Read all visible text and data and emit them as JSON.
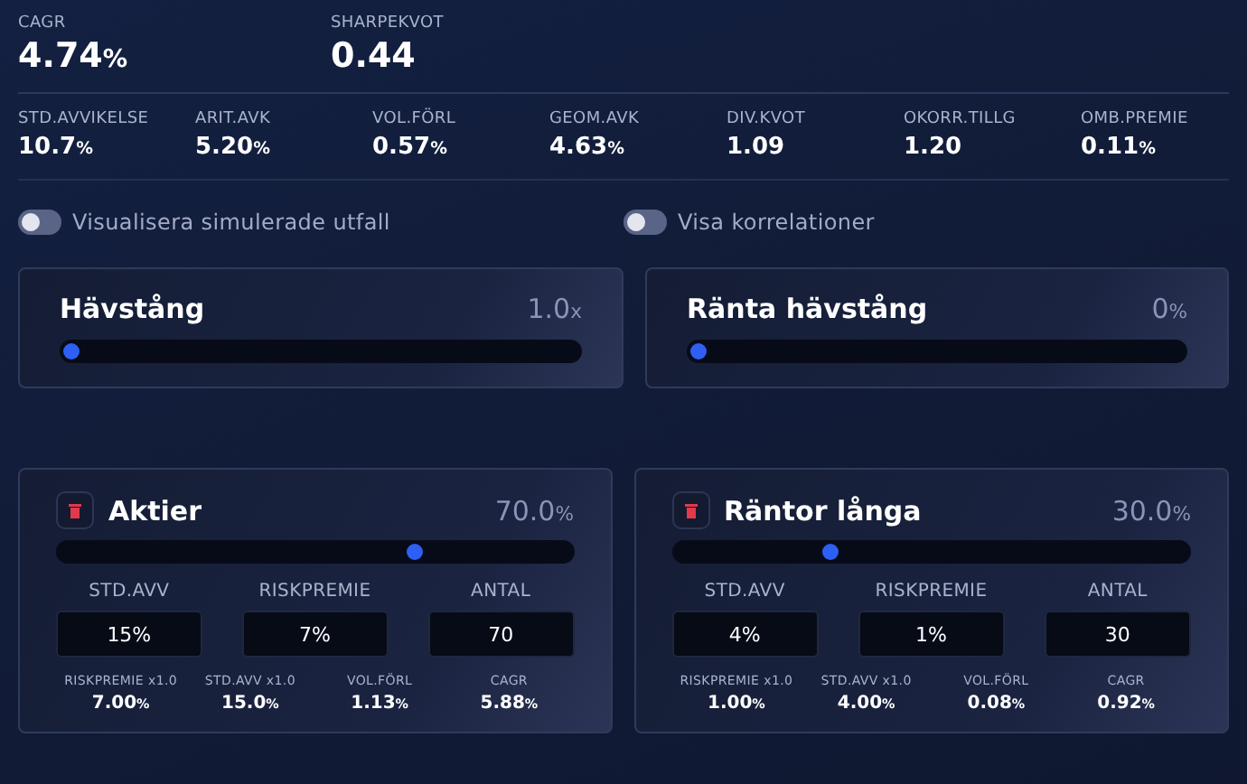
{
  "summary": [
    {
      "label": "CAGR",
      "value": "4.74",
      "unit": "%"
    },
    {
      "label": "SHARPEKVOT",
      "value": "0.44"
    }
  ],
  "metrics": [
    {
      "label": "STD.AVVIKELSE",
      "value": "10.7",
      "unit": "%"
    },
    {
      "label": "ARIT.AVK",
      "value": "5.20",
      "unit": "%"
    },
    {
      "label": "VOL.FÖRL",
      "value": "0.57",
      "unit": "%"
    },
    {
      "label": "GEOM.AVK",
      "value": "4.63",
      "unit": "%"
    },
    {
      "label": "DIV.KVOT",
      "value": "1.09"
    },
    {
      "label": "OKORR.TILLG",
      "value": "1.20"
    },
    {
      "label": "OMB.PREMIE",
      "value": "0.11",
      "unit": "%"
    }
  ],
  "toggles": [
    {
      "label": "Visualisera simulerade utfall",
      "on": false
    },
    {
      "label": "Visa korrelationer",
      "on": false
    }
  ],
  "leverage": [
    {
      "title": "Hävstång",
      "value": "1.0",
      "unit": "x",
      "level": 0
    },
    {
      "title": "Ränta hävstång",
      "value": "0",
      "unit": "%",
      "level": 0
    }
  ],
  "assets": [
    {
      "name": "Aktier",
      "weight": "70.0",
      "unit": "%",
      "level": 0.7,
      "inputs": [
        {
          "label": "STD.AVV",
          "value": "15%"
        },
        {
          "label": "RISKPREMIE",
          "value": "7%"
        },
        {
          "label": "ANTAL",
          "value": "70"
        }
      ],
      "stats": [
        {
          "label": "RISKPREMIE x1.0",
          "value": "7.00",
          "unit": "%"
        },
        {
          "label": "STD.AVV x1.0",
          "value": "15.0",
          "unit": "%"
        },
        {
          "label": "VOL.FÖRL",
          "value": "1.13",
          "unit": "%"
        },
        {
          "label": "CAGR",
          "value": "5.88",
          "unit": "%"
        }
      ]
    },
    {
      "name": "Räntor långa",
      "weight": "30.0",
      "unit": "%",
      "level": 0.3,
      "inputs": [
        {
          "label": "STD.AVV",
          "value": "4%"
        },
        {
          "label": "RISKPREMIE",
          "value": "1%"
        },
        {
          "label": "ANTAL",
          "value": "30"
        }
      ],
      "stats": [
        {
          "label": "RISKPREMIE x1.0",
          "value": "1.00",
          "unit": "%"
        },
        {
          "label": "STD.AVV x1.0",
          "value": "4.00",
          "unit": "%"
        },
        {
          "label": "VOL.FÖRL",
          "value": "0.08",
          "unit": "%"
        },
        {
          "label": "CAGR",
          "value": "0.92",
          "unit": "%"
        }
      ]
    }
  ]
}
